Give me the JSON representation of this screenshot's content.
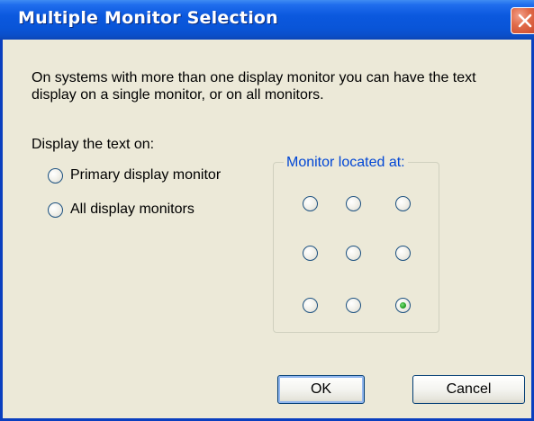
{
  "window": {
    "title": "Multiple Monitor Selection"
  },
  "description": "On systems with more than one display monitor you can have the text display on a single monitor, or on all monitors.",
  "display_label": "Display the text on:",
  "display_options": [
    {
      "label": "Primary display monitor",
      "selected": false
    },
    {
      "label": "All display monitors",
      "selected": false
    }
  ],
  "monitor_group": {
    "legend": "Monitor located at:",
    "grid": [
      [
        false,
        false,
        false
      ],
      [
        false,
        false,
        false
      ],
      [
        false,
        false,
        true
      ]
    ]
  },
  "buttons": {
    "ok_label": "OK",
    "cancel_label": "Cancel"
  },
  "colors": {
    "title_bar": "#0b58de",
    "dialog_background": "#ece9d8",
    "group_legend": "#0046d5",
    "close_button": "#e06a48",
    "radio_checked": "#2aa52a"
  },
  "icons": {
    "close": "close-x-icon"
  }
}
